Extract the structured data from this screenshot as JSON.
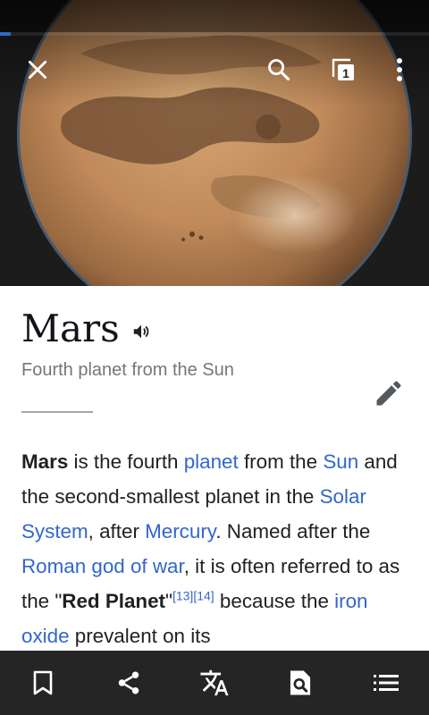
{
  "article": {
    "title": "Mars",
    "description": "Fourth planet from the Sun",
    "body": [
      {
        "t": "Mars",
        "kind": "bold"
      },
      {
        "t": " is the fourth ",
        "kind": "text"
      },
      {
        "t": "planet",
        "kind": "link"
      },
      {
        "t": " from the ",
        "kind": "text"
      },
      {
        "t": "Sun",
        "kind": "link"
      },
      {
        "t": " and the second-smallest planet in the ",
        "kind": "text"
      },
      {
        "t": "Solar System",
        "kind": "link"
      },
      {
        "t": ", after ",
        "kind": "text"
      },
      {
        "t": "Mercury",
        "kind": "link"
      },
      {
        "t": ". Named after the ",
        "kind": "text"
      },
      {
        "t": "Roman god of war",
        "kind": "link"
      },
      {
        "t": ", it is often referred to as the \"",
        "kind": "text"
      },
      {
        "t": "Red Planet",
        "kind": "bold"
      },
      {
        "t": "\"",
        "kind": "text"
      },
      {
        "t": "[13]",
        "kind": "ref"
      },
      {
        "t": "[14]",
        "kind": "ref"
      },
      {
        "t": " because the ",
        "kind": "text"
      },
      {
        "t": "iron oxide",
        "kind": "link"
      },
      {
        "t": " prevalent on its",
        "kind": "text"
      }
    ]
  },
  "toolbar": {
    "tab_count": "1"
  },
  "load_progress": 0.025,
  "icons": {
    "close": "close-icon",
    "search": "search-icon",
    "tabs": "tabs-icon",
    "menu": "overflow-menu-icon",
    "audio": "speaker-icon",
    "edit": "pencil-icon",
    "save": "bookmark-icon",
    "share": "share-icon",
    "language": "translate-icon",
    "find": "find-in-page-icon",
    "contents": "table-of-contents-icon"
  },
  "colors": {
    "link": "#3366cc",
    "toolbar_bg": "#252525",
    "title": "#101418",
    "subtitle": "#72777d"
  }
}
